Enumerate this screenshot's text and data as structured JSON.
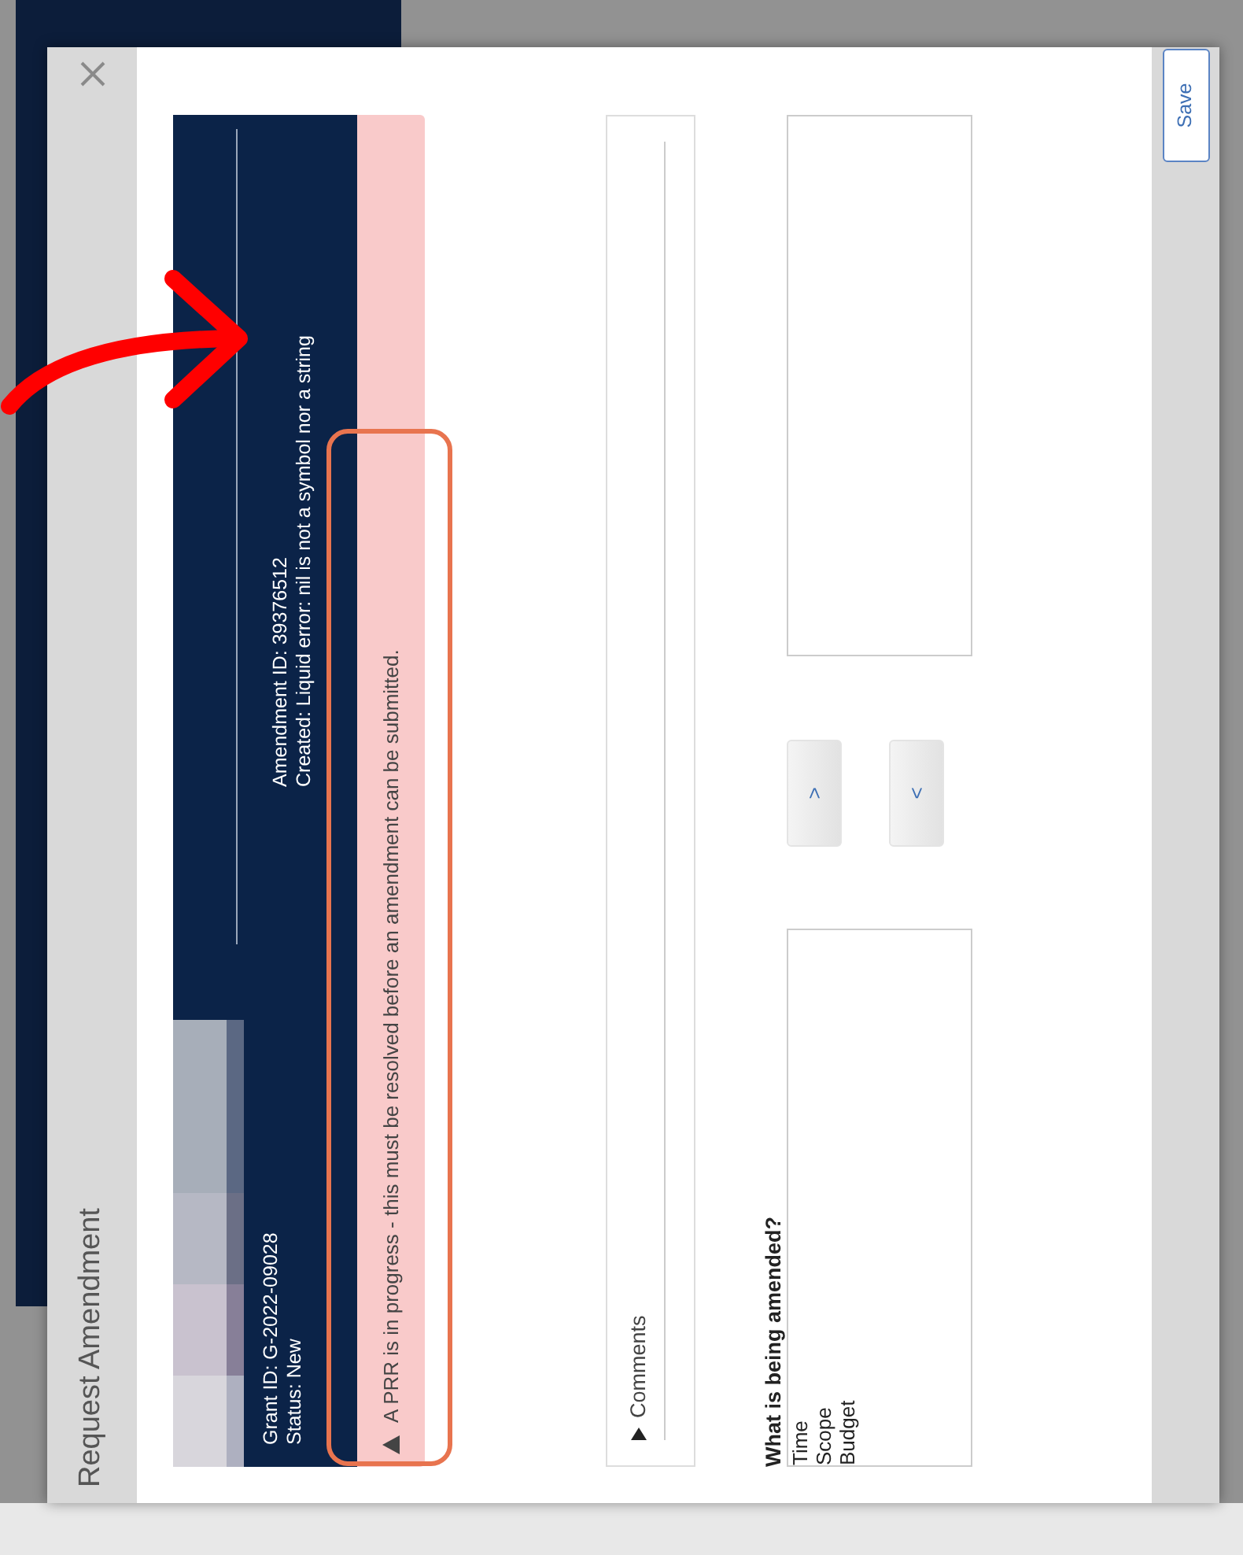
{
  "dialog": {
    "title": "Request Amendment"
  },
  "header": {
    "grant_id": "Grant ID: G-2022-09028",
    "status": "Status: New",
    "amendment_id": "Amendment ID: 39376512",
    "created": "Created: Liquid error: nil is not a symbol nor a string"
  },
  "alert": {
    "text": "A PRR is in progress - this must be resolved before an amendment can be submitted."
  },
  "comments": {
    "label": "Comments",
    "expanded": false
  },
  "amended": {
    "label": "What is being amended?",
    "available": [
      "Time",
      "Scope",
      "Budget"
    ]
  },
  "move_buttons": [
    ">",
    "<"
  ],
  "footer_buttons": [
    "Save"
  ],
  "annotations": [
    {
      "kind": "arrow",
      "color": "#ff0000"
    },
    {
      "kind": "highlight",
      "color": "#e8744f"
    }
  ]
}
